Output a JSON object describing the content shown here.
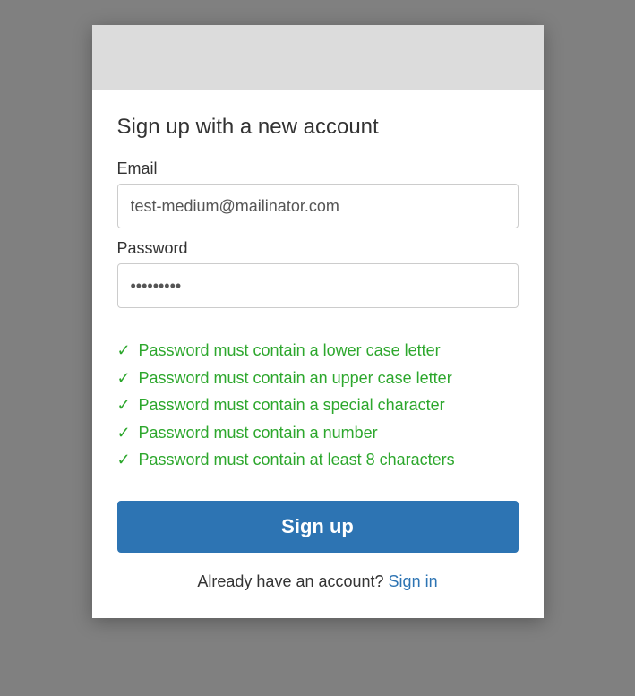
{
  "form": {
    "title": "Sign up with a new account",
    "email_label": "Email",
    "email_value": "test-medium@mailinator.com",
    "password_label": "Password",
    "password_value": "•••••••••",
    "rules": [
      "Password must contain a lower case letter",
      "Password must contain an upper case letter",
      "Password must contain a special character",
      "Password must contain a number",
      "Password must contain at least 8 characters"
    ],
    "submit_label": "Sign up",
    "footer_text": "Already have an account? ",
    "signin_link": "Sign in"
  },
  "colors": {
    "accent": "#2d74b3",
    "success": "#2da72d"
  },
  "icons": {
    "check": "✓"
  }
}
